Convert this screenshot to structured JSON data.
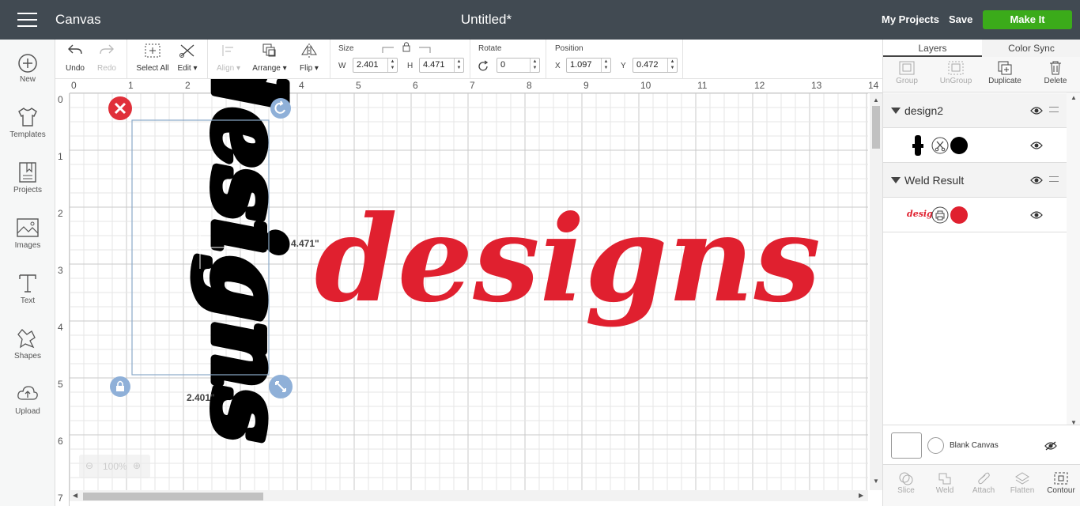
{
  "topbar": {
    "app_title": "Canvas",
    "doc_title": "Untitled*",
    "my_projects": "My Projects",
    "save": "Save",
    "make_it": "Make It"
  },
  "sidebar": {
    "items": [
      {
        "label": "New",
        "icon": "plus-circle-icon"
      },
      {
        "label": "Templates",
        "icon": "tshirt-icon"
      },
      {
        "label": "Projects",
        "icon": "bookmark-icon"
      },
      {
        "label": "Images",
        "icon": "image-icon"
      },
      {
        "label": "Text",
        "icon": "text-t-icon"
      },
      {
        "label": "Shapes",
        "icon": "shapes-icon"
      },
      {
        "label": "Upload",
        "icon": "cloud-upload-icon"
      }
    ]
  },
  "toolbar": {
    "undo": "Undo",
    "redo": "Redo",
    "select_all": "Select All",
    "edit": "Edit",
    "align": "Align",
    "arrange": "Arrange",
    "flip": "Flip",
    "size_label": "Size",
    "w_label": "W",
    "w_value": "2.401",
    "h_label": "H",
    "h_value": "4.471",
    "rotate_label": "Rotate",
    "rotate_value": "0",
    "position_label": "Position",
    "x_label": "X",
    "x_value": "1.097",
    "y_label": "Y",
    "y_value": "0.472"
  },
  "canvas": {
    "ruler_top": [
      "0",
      "1",
      "2",
      "3",
      "4",
      "5",
      "6",
      "7",
      "8",
      "9",
      "10",
      "11",
      "12",
      "13",
      "14"
    ],
    "ruler_left": [
      "0",
      "1",
      "2",
      "3",
      "4",
      "5",
      "6",
      "7"
    ],
    "selected_text": "designs",
    "design_text": "designs",
    "design_color": "#e0202f",
    "selection_color": "#000000",
    "height_readout": "4.471\"",
    "width_readout": "2.401\"",
    "zoom": "100%"
  },
  "right_panel": {
    "tabs": [
      "Layers",
      "Color Sync"
    ],
    "actions": [
      "Group",
      "UnGroup",
      "Duplicate",
      "Delete"
    ],
    "groups": [
      {
        "name": "design2",
        "swatch": "#000000"
      },
      {
        "name": "Weld Result",
        "swatch": "#e0202f",
        "thumb": "designs"
      }
    ],
    "blank_canvas": "Blank Canvas",
    "bottom_actions": [
      "Slice",
      "Weld",
      "Attach",
      "Flatten",
      "Contour"
    ]
  }
}
